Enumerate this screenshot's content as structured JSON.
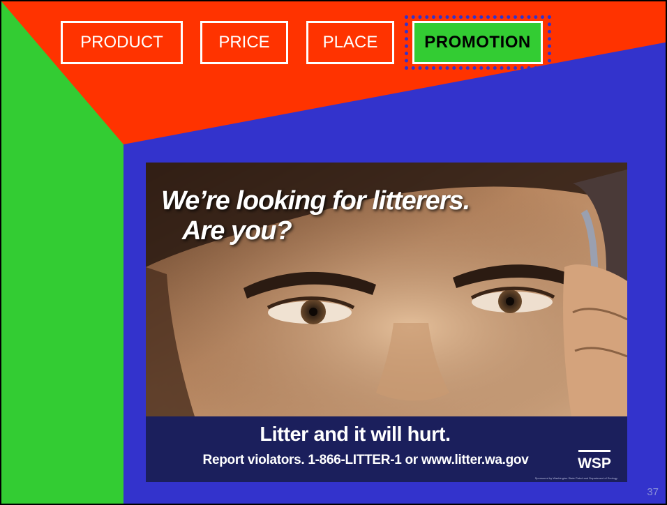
{
  "nav": {
    "tabs": [
      {
        "label": "PRODUCT"
      },
      {
        "label": "PRICE"
      },
      {
        "label": "PLACE"
      },
      {
        "label": "PROMOTION",
        "active": true
      }
    ]
  },
  "ad": {
    "headline_line1": "We’re looking for litterers.",
    "headline_line2": "Are you?",
    "tagline": "Litter and it will hurt.",
    "report_line": "Report violators. 1-866-LITTER-1 or www.litter.wa.gov",
    "logo_text": "WSP",
    "sponsor_text": "Sponsored by Washington State Patrol and Department of Ecology"
  },
  "slide": {
    "page_number": "37"
  },
  "colors": {
    "green": "#33cc33",
    "red": "#ff3300",
    "blue": "#3333cc",
    "banner": "#1b1f5c"
  }
}
